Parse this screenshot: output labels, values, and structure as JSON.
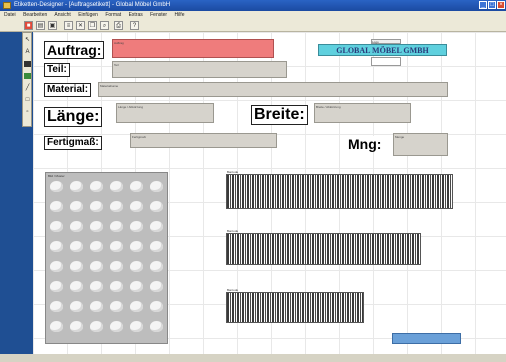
{
  "window": {
    "title": "Etiketten-Designer - [Auftragsetikett] - Global Möbel GmbH"
  },
  "menu": [
    "Datei",
    "Bearbeiten",
    "Ansicht",
    "Einfügen",
    "Format",
    "Extras",
    "Fenster",
    "Hilfe"
  ],
  "labels": {
    "auftrag": "Auftrag:",
    "teil": "Teil:",
    "material": "Material:",
    "laenge": "Länge:",
    "breite": "Breite:",
    "fertigmass": "Fertigmaß:",
    "mng": "Mng:"
  },
  "fields": {
    "auftrag": "Auftrag",
    "teil": "Teil",
    "material": "Materialname",
    "laenge": "Länge / Abkürzung",
    "breite": "Breite / Abkürzung",
    "fertigmass": "Fertigmaß",
    "mng": "Menge",
    "logo_tag": "Logo"
  },
  "logo": {
    "text": "GLOBAL MÖBEL GMBH"
  },
  "barcodes": [
    "Barcode",
    "Barcode",
    "Barcode"
  ],
  "pattern_label": "Bild / Muster",
  "colors": {
    "accent_red": "#ef7c7c",
    "logo_bg": "#5fd0de",
    "desktop": "#1f4f93"
  }
}
